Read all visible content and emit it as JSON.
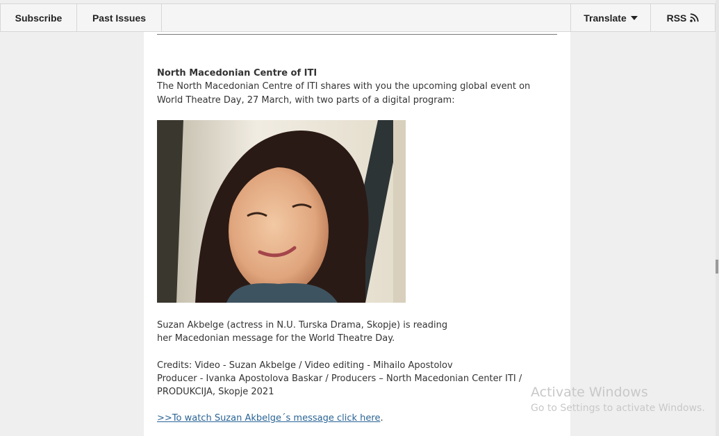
{
  "nav": {
    "subscribe": "Subscribe",
    "past_issues": "Past Issues",
    "translate": "Translate",
    "rss": "RSS"
  },
  "article": {
    "title": "North Macedonian Centre of ITI",
    "intro_line1": "The North Macedonian Centre of ITI shares with you the upcoming global event on",
    "intro_line2": "World Theatre Day, 27 March, with two parts of a digital program:",
    "caption_line1": "Suzan Akbelge (actress in N.U. Turska Drama, Skopje) is reading",
    "caption_line2": "her Macedonian message for the World Theatre Day.",
    "credits_line1": "Credits: Video - Suzan Akbelge / Video editing - Mihailo Apostolov",
    "credits_line2": "Producer - Ivanka Apostolova Baskar / Producers – North Macedonian Center ITI /",
    "credits_line3": "PRODUKCIJA, Skopje 2021",
    "link_text": ">>To watch Suzan Akbelge´s message click here",
    "link_suffix": "."
  },
  "watermark": {
    "title": "Activate Windows",
    "subtitle": "Go to Settings to activate Windows."
  },
  "colors": {
    "link": "#2a6496",
    "text": "#333333",
    "page_bg": "#efefef",
    "content_bg": "#ffffff"
  },
  "icons": {
    "translate_caret": "caret-down-icon",
    "rss": "rss-icon"
  }
}
